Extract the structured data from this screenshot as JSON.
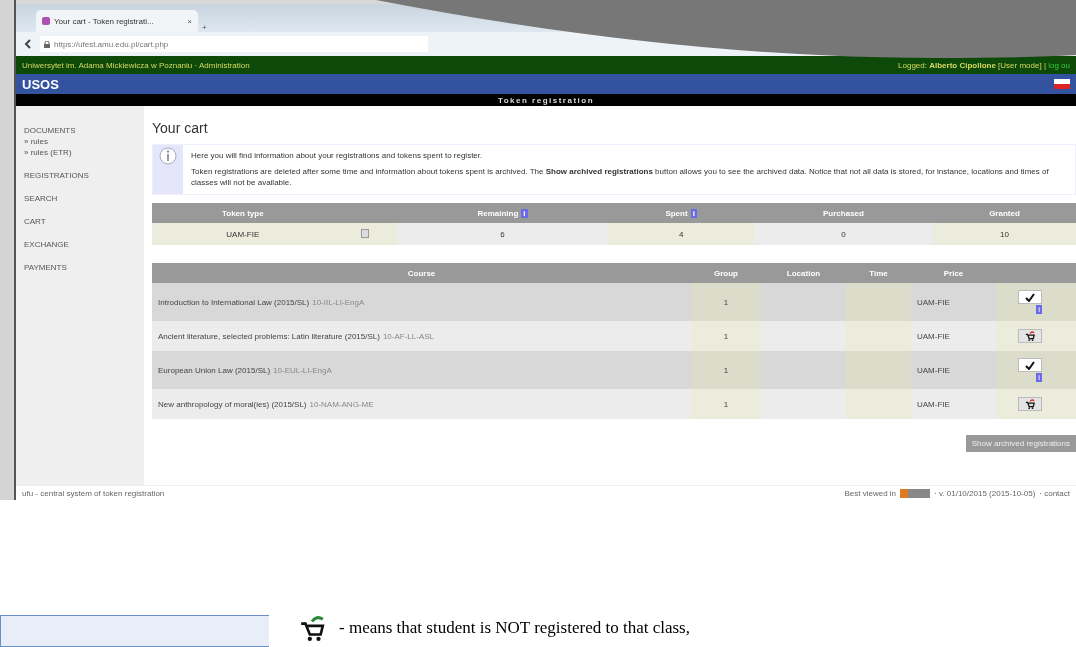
{
  "browser": {
    "tab_title": "Your cart - Token registrati...",
    "tab_close": "×",
    "new_tab": "+",
    "url": "https://ufest.amu.edu.pl/cart.php"
  },
  "top_bar": {
    "university": "Uniwersytet im. Adama Mickiewicza w Poznaniu · Administration",
    "login_label": "Logged:",
    "user": "Alberto Cipollone",
    "mode": "[User mode] |",
    "logout": "log ou"
  },
  "header": {
    "logo": "USOS",
    "section_title": "Token registration"
  },
  "sidebar": {
    "items": [
      {
        "label": "DOCUMENTS",
        "children": [
          {
            "label": "» rules"
          },
          {
            "label": "» rules (ETR)"
          }
        ]
      },
      {
        "label": "REGISTRATIONS"
      },
      {
        "label": "SEARCH"
      },
      {
        "label": "CART"
      },
      {
        "label": "EXCHANGE"
      },
      {
        "label": "PAYMENTS"
      }
    ]
  },
  "page_title": "Your cart",
  "info": [
    "Here you will find information about your registrations and tokens spent to register.",
    "Token registrations are deleted after some time and information about tokens spent is archived. The **Show archived registrations** button allows you to see the archived data. Notice that not all data is stored, for instance, locations and times of classes will not be available."
  ],
  "tokens": {
    "columns": [
      {
        "label": "Token type"
      },
      {
        "label": "Remaining",
        "badge": "i"
      },
      {
        "label": "Spent",
        "badge": "i"
      },
      {
        "label": "Purchased"
      },
      {
        "label": "Granted"
      }
    ],
    "row": [
      "UAM-FIE",
      "6",
      "4",
      "0",
      "10"
    ]
  },
  "courses": {
    "columns": [
      "Course",
      "Group",
      "Location",
      "Time",
      "Price"
    ],
    "rows": [
      {
        "course": "Introduction to International Law (2015/SL)",
        "code": "10-IIL-LI-EngA",
        "group": "1",
        "price": "UAM-FIE",
        "registered": true,
        "badge": "i"
      },
      {
        "course": "Ancient literature, selected problems: Latin literature (2015/SL)",
        "code": "10-AF-LL-ASL",
        "group": "1",
        "price": "UAM-FIE",
        "registered": false
      },
      {
        "course": "European Union Law (2015/SL)",
        "code": "10-EUL-LI-EngA",
        "group": "1",
        "price": "UAM-FIE",
        "registered": true,
        "badge": "i"
      },
      {
        "course": "New anthropology of moral(ies) (2015/SL)",
        "code": "10-NAM-ANG-ME",
        "group": "1",
        "price": "UAM-FIE",
        "registered": false
      }
    ]
  },
  "archive_button": "Show archived registrations",
  "footer": {
    "left": "ufu - central system of token registration",
    "best_viewed": "Best viewed in",
    "version": "· v. 01/10/2015 (2015-10-05)",
    "contact": "· contact"
  },
  "caption": "- means that student is NOT registered to that class,"
}
